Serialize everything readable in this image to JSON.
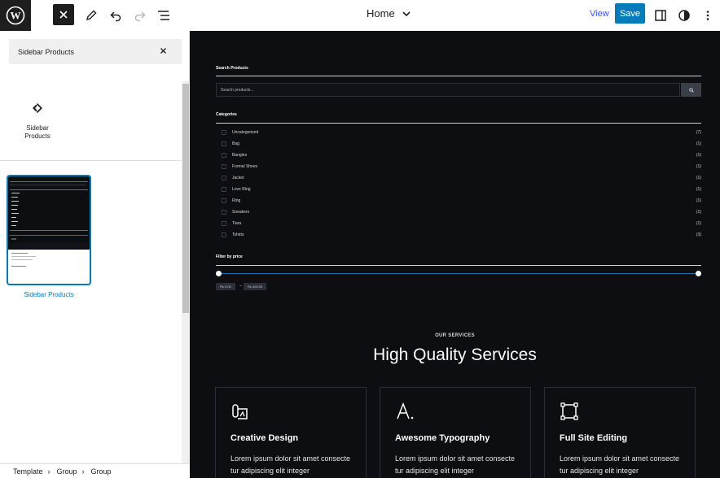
{
  "topbar": {
    "document_title": "Home",
    "view_label": "View",
    "save_label": "Save"
  },
  "sidebar": {
    "search_value": "Sidebar Products",
    "block_label": "Sidebar Products",
    "preview_label": "Sidebar Products"
  },
  "breadcrumb": {
    "items": [
      "Template",
      "Group",
      "Group"
    ]
  },
  "canvas": {
    "search_title": "Search Products",
    "search_placeholder": "Search products...",
    "categories_title": "Categories",
    "categories": [
      {
        "name": "Uncategorized",
        "count": "(7)"
      },
      {
        "name": "Bag",
        "count": "(1)"
      },
      {
        "name": "Bangles",
        "count": "(1)"
      },
      {
        "name": "Formal Shoes",
        "count": "(1)"
      },
      {
        "name": "Jacket",
        "count": "(1)"
      },
      {
        "name": "Love Ring",
        "count": "(1)"
      },
      {
        "name": "Ring",
        "count": "(1)"
      },
      {
        "name": "Sneakers",
        "count": "(1)"
      },
      {
        "name": "Tiara",
        "count": "(1)"
      },
      {
        "name": "Tshirts",
        "count": "(3)"
      }
    ],
    "price_title": "Filter by price",
    "price_min": "Rs 0.00",
    "price_max": "Rs 400.00",
    "price_sep": "–",
    "services_eyebrow": "OUR SERVICES",
    "services_title": "High Quality Services",
    "cards": [
      {
        "icon": "design-icon",
        "title": "Creative Design",
        "text": "Lorem ipsum dolor sit amet consecte tur adipiscing elit integer"
      },
      {
        "icon": "typography-icon",
        "title": "Awesome Typography",
        "text": "Lorem ipsum dolor sit amet consecte tur adipiscing elit integer"
      },
      {
        "icon": "site-editing-icon",
        "title": "Full Site Editing",
        "text": "Lorem ipsum dolor sit amet consecte tur adipiscing elit integer"
      }
    ]
  },
  "colors": {
    "accent": "#007cba",
    "canvas_bg": "#0d0e12",
    "wp_dark": "#1e1e1e"
  }
}
